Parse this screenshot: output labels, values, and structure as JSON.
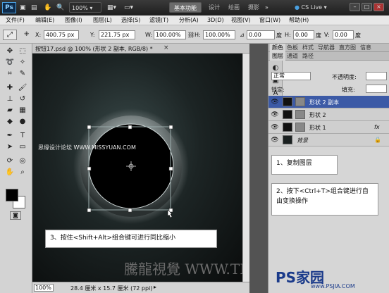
{
  "titlebar": {
    "logo": "Ps",
    "zoom_value": "100%",
    "workspaces": [
      "基本功能",
      "设计",
      "绘画",
      "摄影"
    ],
    "more": "»",
    "cs_live": "CS Live"
  },
  "menu": [
    "文件(F)",
    "编辑(E)",
    "图像(I)",
    "图层(L)",
    "选择(S)",
    "滤镜(T)",
    "分析(A)",
    "3D(D)",
    "视图(V)",
    "窗口(W)",
    "帮助(H)"
  ],
  "options": {
    "x_label": "X:",
    "x_value": "400.75 px",
    "y_label": "Y:",
    "y_value": "221.75 px",
    "w_label": "W:",
    "w_value": "100.00%",
    "h_label": "H:",
    "h_value": "100.00%",
    "angle_value": "0.00",
    "angle_unit": "度",
    "hskew_label": "H:",
    "hskew_value": "0.00",
    "hskew_unit": "度",
    "vskew_label": "V:",
    "vskew_value": "0.00",
    "vskew_unit": "度"
  },
  "document": {
    "tab_title": "按钮17.psd @ 100% (形状 2 副本, RGB/8) *",
    "close": "×",
    "watermark_top": "思缘设计论坛 WWW.MISSYUAN.COM",
    "watermark_bottom": "騰龍視覺 WWW.TL.V"
  },
  "status": {
    "zoom": "100%",
    "info": "28.4 厘米 x 15.7 厘米 (72 ppi)"
  },
  "panels": {
    "top_tabs": [
      "颜色",
      "色板",
      "样式",
      "导航器",
      "直方图",
      "信息"
    ],
    "layer_tabs": [
      "图层",
      "通道",
      "路径"
    ],
    "blend_mode": "正常",
    "opacity_label": "不透明度:",
    "lock_label": "锁定:",
    "fill_label": "填充:",
    "layers": [
      {
        "name": "形状 2 副本",
        "selected": true
      },
      {
        "name": "形状 2",
        "selected": false
      },
      {
        "name": "形状 1",
        "selected": false,
        "fx": "fx"
      },
      {
        "name": "背景",
        "selected": false
      }
    ]
  },
  "notes": {
    "step1": "1、复制图层",
    "step2": "2、按下<Ctrl+T>组合键进行自由变换操作",
    "step3": "3、按住<Shift+Alt>组合键可进行同比缩小"
  },
  "brand": {
    "name": "PS家园",
    "url": "www.PSJIA.COM"
  },
  "colors": {
    "selected_layer": "#3c5aa6",
    "canvas_dark": "#0a0c0c"
  }
}
